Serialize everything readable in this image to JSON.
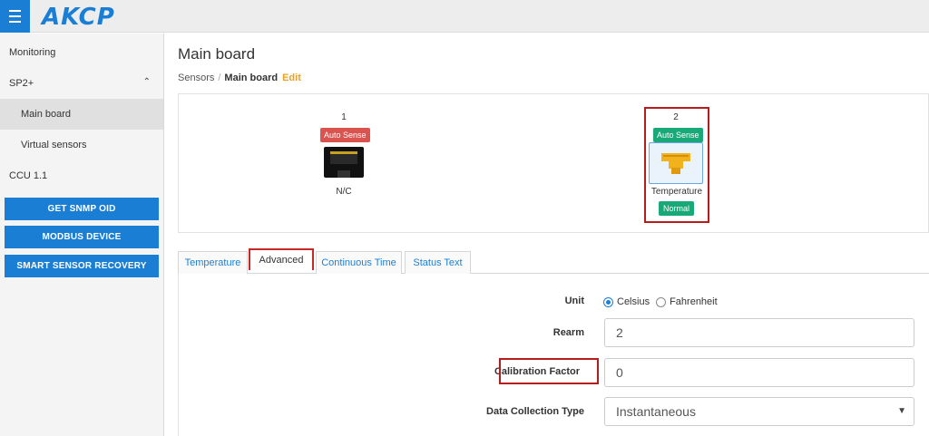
{
  "app": {
    "logo_text": "AKCP",
    "brand_color": "#1a7fd4",
    "menu_icon": "hamburger-icon"
  },
  "sidebar": {
    "items": [
      {
        "label": "Monitoring"
      },
      {
        "label": "SP2+",
        "icon": "chevron-up-icon",
        "chevron": "⌃"
      },
      {
        "label": "Main board",
        "active": true
      },
      {
        "label": "Virtual sensors"
      },
      {
        "label": "CCU 1.1"
      }
    ],
    "buttons": [
      {
        "label": "GET SNMP OID"
      },
      {
        "label": "MODBUS DEVICE"
      },
      {
        "label": "SMART SENSOR RECOVERY"
      }
    ]
  },
  "main": {
    "title": "Main board",
    "breadcrumb": {
      "root": "Sensors",
      "separator": "/",
      "current": "Main board",
      "edit": "Edit"
    }
  },
  "ports": [
    {
      "number": "1",
      "mode": "Auto Sense",
      "mode_color": "#d9534f",
      "label": "N/C",
      "icon": "rj45-port-icon"
    },
    {
      "number": "2",
      "mode": "Auto Sense",
      "mode_color": "#19a979",
      "label": "Temperature",
      "status": "Normal",
      "status_color": "#19a979",
      "icon": "temperature-sensor-icon"
    }
  ],
  "tabs": [
    {
      "label": "Temperature"
    },
    {
      "label": "Advanced",
      "active": true
    },
    {
      "label": "Continuous Time"
    },
    {
      "label": "Status Text"
    }
  ],
  "form": {
    "unit_label": "Unit",
    "unit_options": [
      "Celsius",
      "Fahrenheit"
    ],
    "unit_selected": "Celsius",
    "rearm_label": "Rearm",
    "rearm_value": "2",
    "calibration_label": "Calibration Factor",
    "calibration_value": "0",
    "data_collection_label": "Data Collection Type",
    "data_collection_value": "Instantaneous"
  }
}
